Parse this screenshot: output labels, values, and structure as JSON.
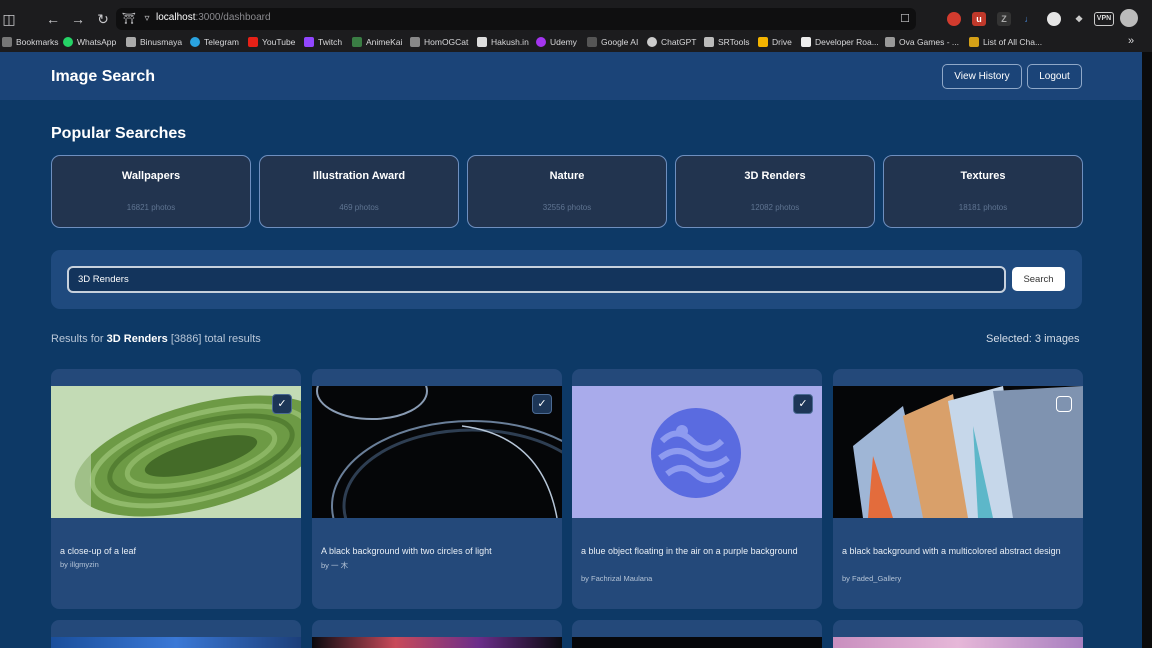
{
  "browser": {
    "url_host": "localhost",
    "url_path": ":3000/dashboard",
    "bookmarks": [
      "Bookmarks",
      "WhatsApp",
      "Binusmaya",
      "Telegram",
      "YouTube",
      "Twitch",
      "AnimeKai",
      "HomOGCat",
      "Hakush.in",
      "Udemy",
      "Google AI",
      "ChatGPT",
      "SRTools",
      "Drive",
      "Developer Roa...",
      "Ova Games - ...",
      "List of All Cha..."
    ],
    "vpn_label": "VPN"
  },
  "header": {
    "title": "Image Search",
    "view_history_label": "View History",
    "logout_label": "Logout"
  },
  "popular": {
    "title": "Popular Searches",
    "items": [
      {
        "name": "Wallpapers",
        "count": "16821 photos"
      },
      {
        "name": "Illustration Award",
        "count": "469 photos"
      },
      {
        "name": "Nature",
        "count": "32556 photos"
      },
      {
        "name": "3D Renders",
        "count": "12082 photos"
      },
      {
        "name": "Textures",
        "count": "18181 photos"
      }
    ]
  },
  "search": {
    "value": "3D Renders",
    "button_label": "Search"
  },
  "results": {
    "prefix": "Results for",
    "query": "3D Renders",
    "total": "[3886]",
    "suffix": "total results",
    "selected": "Selected: 3 images"
  },
  "cards": [
    {
      "description": "a close-up of a leaf",
      "author": "by illgmyzin",
      "checked": true
    },
    {
      "description": "A black background with two circles of light",
      "author": "by 一 木",
      "checked": true
    },
    {
      "description": "a blue object floating in the air on a purple background",
      "author": "by Fachrizal Maulana",
      "checked": true
    },
    {
      "description": "a black background with a multicolored abstract design",
      "author": "by Faded_Gallery",
      "checked": false
    }
  ],
  "colors": {
    "page_bg": "#0d3966",
    "header_bg": "#1b4478",
    "card_bg": "#24497a",
    "popular_card_bg": "#22344f",
    "accent_border": "#6e8fbf"
  }
}
